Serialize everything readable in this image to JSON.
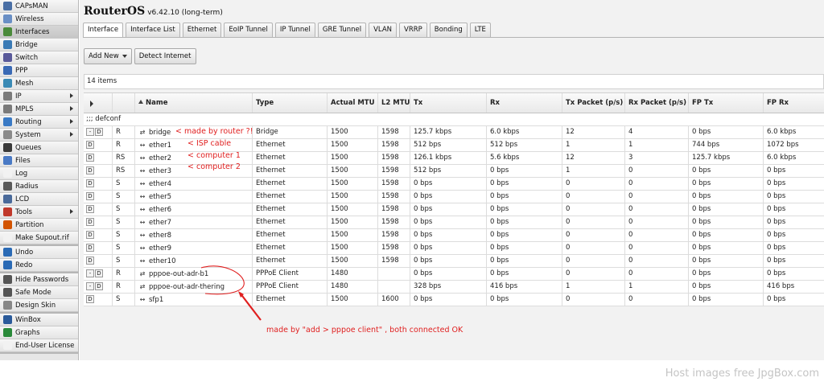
{
  "sidebar": {
    "groups": [
      [
        {
          "label": "CAPsMAN",
          "icon": "capsman-icon",
          "color": "#4a6fa5"
        },
        {
          "label": "Wireless",
          "icon": "wireless-icon",
          "color": "#6a8fc5"
        },
        {
          "label": "Interfaces",
          "icon": "interfaces-icon",
          "color": "#4a8a3a",
          "active": true
        },
        {
          "label": "Bridge",
          "icon": "bridge-icon",
          "color": "#3a7ab5"
        },
        {
          "label": "Switch",
          "icon": "switch-icon",
          "color": "#5a5a9a"
        },
        {
          "label": "PPP",
          "icon": "ppp-icon",
          "color": "#3a6ab5"
        },
        {
          "label": "Mesh",
          "icon": "mesh-icon",
          "color": "#3a8ab5"
        },
        {
          "label": "IP",
          "icon": "ip-icon",
          "color": "#7a7a7a",
          "submenu": true
        },
        {
          "label": "MPLS",
          "icon": "mpls-icon",
          "color": "#7a7a7a",
          "submenu": true
        },
        {
          "label": "Routing",
          "icon": "routing-icon",
          "color": "#3a7ac5",
          "submenu": true
        },
        {
          "label": "System",
          "icon": "system-icon",
          "color": "#8a8a8a",
          "submenu": true
        },
        {
          "label": "Queues",
          "icon": "queues-icon",
          "color": "#3a3a3a"
        },
        {
          "label": "Files",
          "icon": "files-icon",
          "color": "#4a7ac5"
        },
        {
          "label": "Log",
          "icon": "log-icon",
          "color": "#f2f2f2"
        },
        {
          "label": "Radius",
          "icon": "radius-icon",
          "color": "#5a5a5a"
        },
        {
          "label": "LCD",
          "icon": "lcd-icon",
          "color": "#4a6a9a"
        },
        {
          "label": "Tools",
          "icon": "tools-icon",
          "color": "#c0392b",
          "submenu": true
        },
        {
          "label": "Partition",
          "icon": "partition-icon",
          "color": "#d35400"
        },
        {
          "label": "Make Supout.rif",
          "icon": "supout-icon",
          "color": "#f2f2f2"
        }
      ],
      [
        {
          "label": "Undo",
          "icon": "undo-icon",
          "color": "#2a6ab5"
        },
        {
          "label": "Redo",
          "icon": "redo-icon",
          "color": "#2a6ab5"
        }
      ],
      [
        {
          "label": "Hide Passwords",
          "icon": "hide-passwords-icon",
          "color": "#555555"
        },
        {
          "label": "Safe Mode",
          "icon": "safe-mode-icon",
          "color": "#555555"
        },
        {
          "label": "Design Skin",
          "icon": "design-skin-icon",
          "color": "#888888"
        }
      ],
      [
        {
          "label": "WinBox",
          "icon": "winbox-icon",
          "color": "#2a5a9a"
        },
        {
          "label": "Graphs",
          "icon": "graphs-icon",
          "color": "#2a8a3a"
        },
        {
          "label": "End-User License",
          "icon": "license-icon",
          "color": "#f2f2f2"
        }
      ]
    ]
  },
  "header": {
    "title": "RouterOS",
    "version": "v6.42.10 (long-term)"
  },
  "tabs": [
    "Interface",
    "Interface List",
    "Ethernet",
    "EoIP Tunnel",
    "IP Tunnel",
    "GRE Tunnel",
    "VLAN",
    "VRRP",
    "Bonding",
    "LTE"
  ],
  "toolbar": {
    "add_label": "Add New",
    "detect_label": "Detect Internet"
  },
  "items_count": "14 items",
  "table": {
    "columns": [
      "Name",
      "Type",
      "Actual MTU",
      "L2 MTU",
      "Tx",
      "Rx",
      "Tx Packet (p/s)",
      "Rx Packet (p/s)",
      "FP Tx",
      "FP Rx"
    ],
    "comment": ";;; defconf",
    "rows": [
      {
        "btns": [
          "-",
          "D"
        ],
        "flags": "R",
        "icon": "bridge",
        "name": "bridge",
        "type": "Bridge",
        "mtu": "1500",
        "l2mtu": "1598",
        "tx": "125.7 kbps",
        "rx": "6.0 kbps",
        "txp": "12",
        "rxp": "4",
        "fptx": "0 bps",
        "fprx": "6.0 kbps"
      },
      {
        "btns": [
          "D"
        ],
        "flags": "R",
        "icon": "eth",
        "name": "ether1",
        "type": "Ethernet",
        "mtu": "1500",
        "l2mtu": "1598",
        "tx": "512 bps",
        "rx": "512 bps",
        "txp": "1",
        "rxp": "1",
        "fptx": "744 bps",
        "fprx": "1072 bps"
      },
      {
        "btns": [
          "D"
        ],
        "flags": "RS",
        "icon": "eth",
        "name": "ether2",
        "type": "Ethernet",
        "mtu": "1500",
        "l2mtu": "1598",
        "tx": "126.1 kbps",
        "rx": "5.6 kbps",
        "txp": "12",
        "rxp": "3",
        "fptx": "125.7 kbps",
        "fprx": "6.0 kbps"
      },
      {
        "btns": [
          "D"
        ],
        "flags": "RS",
        "icon": "eth",
        "name": "ether3",
        "type": "Ethernet",
        "mtu": "1500",
        "l2mtu": "1598",
        "tx": "512 bps",
        "rx": "0 bps",
        "txp": "1",
        "rxp": "0",
        "fptx": "0 bps",
        "fprx": "0 bps"
      },
      {
        "btns": [
          "D"
        ],
        "flags": "S",
        "icon": "eth",
        "name": "ether4",
        "type": "Ethernet",
        "mtu": "1500",
        "l2mtu": "1598",
        "tx": "0 bps",
        "rx": "0 bps",
        "txp": "0",
        "rxp": "0",
        "fptx": "0 bps",
        "fprx": "0 bps"
      },
      {
        "btns": [
          "D"
        ],
        "flags": "S",
        "icon": "eth",
        "name": "ether5",
        "type": "Ethernet",
        "mtu": "1500",
        "l2mtu": "1598",
        "tx": "0 bps",
        "rx": "0 bps",
        "txp": "0",
        "rxp": "0",
        "fptx": "0 bps",
        "fprx": "0 bps"
      },
      {
        "btns": [
          "D"
        ],
        "flags": "S",
        "icon": "eth",
        "name": "ether6",
        "type": "Ethernet",
        "mtu": "1500",
        "l2mtu": "1598",
        "tx": "0 bps",
        "rx": "0 bps",
        "txp": "0",
        "rxp": "0",
        "fptx": "0 bps",
        "fprx": "0 bps"
      },
      {
        "btns": [
          "D"
        ],
        "flags": "S",
        "icon": "eth",
        "name": "ether7",
        "type": "Ethernet",
        "mtu": "1500",
        "l2mtu": "1598",
        "tx": "0 bps",
        "rx": "0 bps",
        "txp": "0",
        "rxp": "0",
        "fptx": "0 bps",
        "fprx": "0 bps"
      },
      {
        "btns": [
          "D"
        ],
        "flags": "S",
        "icon": "eth",
        "name": "ether8",
        "type": "Ethernet",
        "mtu": "1500",
        "l2mtu": "1598",
        "tx": "0 bps",
        "rx": "0 bps",
        "txp": "0",
        "rxp": "0",
        "fptx": "0 bps",
        "fprx": "0 bps"
      },
      {
        "btns": [
          "D"
        ],
        "flags": "S",
        "icon": "eth",
        "name": "ether9",
        "type": "Ethernet",
        "mtu": "1500",
        "l2mtu": "1598",
        "tx": "0 bps",
        "rx": "0 bps",
        "txp": "0",
        "rxp": "0",
        "fptx": "0 bps",
        "fprx": "0 bps"
      },
      {
        "btns": [
          "D"
        ],
        "flags": "S",
        "icon": "eth",
        "name": "ether10",
        "type": "Ethernet",
        "mtu": "1500",
        "l2mtu": "1598",
        "tx": "0 bps",
        "rx": "0 bps",
        "txp": "0",
        "rxp": "0",
        "fptx": "0 bps",
        "fprx": "0 bps"
      },
      {
        "btns": [
          "-",
          "D"
        ],
        "flags": "R",
        "icon": "ppp",
        "name": "pppoe-out-adr-b1",
        "type": "PPPoE Client",
        "mtu": "1480",
        "l2mtu": "",
        "tx": "0 bps",
        "rx": "0 bps",
        "txp": "0",
        "rxp": "0",
        "fptx": "0 bps",
        "fprx": "0 bps"
      },
      {
        "btns": [
          "-",
          "D"
        ],
        "flags": "R",
        "icon": "ppp",
        "name": "pppoe-out-adr-thering",
        "type": "PPPoE Client",
        "mtu": "1480",
        "l2mtu": "",
        "tx": "328 bps",
        "rx": "416 bps",
        "txp": "1",
        "rxp": "1",
        "fptx": "0 bps",
        "fprx": "416 bps"
      },
      {
        "btns": [
          "D"
        ],
        "flags": "S",
        "icon": "eth",
        "name": "sfp1",
        "type": "Ethernet",
        "mtu": "1500",
        "l2mtu": "1600",
        "tx": "0 bps",
        "rx": "0 bps",
        "txp": "0",
        "rxp": "0",
        "fptx": "0 bps",
        "fprx": "0 bps"
      }
    ]
  },
  "annotations": {
    "bridge": "< made by router ?!",
    "ether1": "< ISP cable",
    "ether2": "< computer 1",
    "ether3": "< computer 2",
    "pppoe": "made by \"add > pppoe client\" , both connected OK",
    "color": "#e02020"
  },
  "watermark": "Host images free JpgBox.com"
}
